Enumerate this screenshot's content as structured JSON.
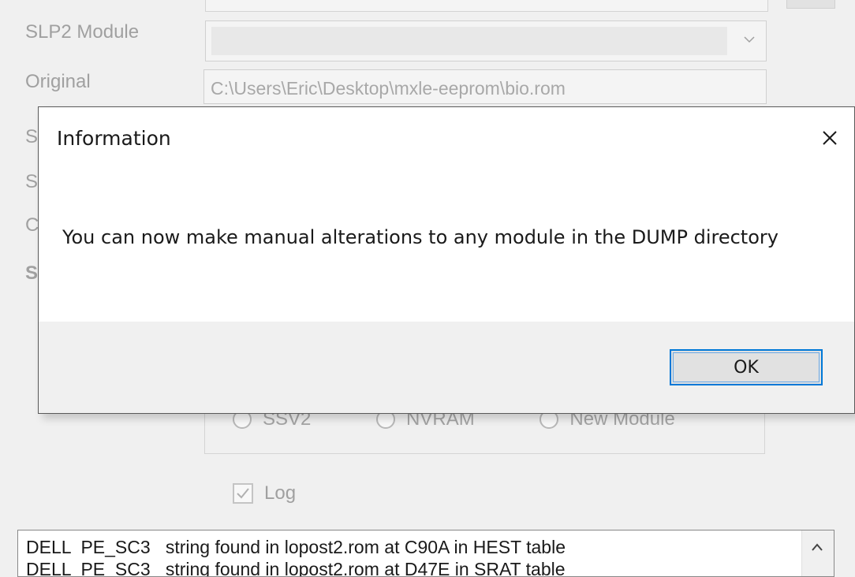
{
  "background": {
    "labels": [
      "SLP2 Module",
      "Original",
      "S",
      "S",
      "C",
      "S"
    ],
    "original_path": "C:\\Users\\Eric\\Desktop\\mxle-eeprom\\bio.rom",
    "radio_options": [
      "SSV2",
      "NVRAM",
      "New Module"
    ],
    "log_checkbox_label": "Log",
    "log_lines": [
      "DELL  PE_SC3   string found in lopost2.rom at C90A in HEST table",
      "DELL  PE_SC3   string found in lopost2.rom at D47E in SRAT table"
    ]
  },
  "dialog": {
    "title": "Information",
    "message": "You can now make manual alterations to any module in the DUMP directory",
    "ok_label": "OK",
    "accent_color": "#0078d7"
  }
}
